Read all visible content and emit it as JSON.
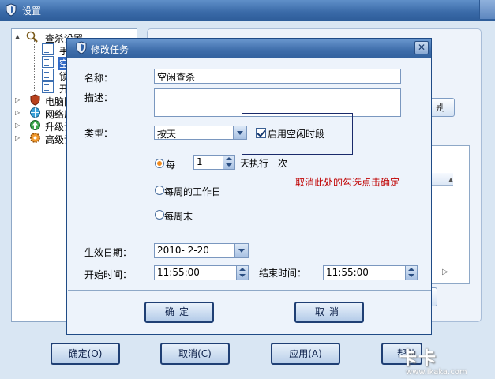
{
  "window": {
    "title": "设置",
    "tree": [
      {
        "label": "查杀设置",
        "expanded": true
      },
      {
        "label": "手"
      },
      {
        "label": "空"
      },
      {
        "label": "锁"
      },
      {
        "label": "开"
      },
      {
        "label": "电脑防"
      },
      {
        "label": "网络层"
      },
      {
        "label": "升级设"
      },
      {
        "label": "高级设"
      }
    ],
    "partial_button": "别",
    "buttons": {
      "ok": "确定(O)",
      "cancel": "取消(C)",
      "apply": "应用(A)",
      "help": "帮助"
    }
  },
  "dialog": {
    "title": "修改任务",
    "name_label": "名称：",
    "name_value": "空闲查杀",
    "desc_label": "描述：",
    "desc_value": "",
    "type_label": "类型：",
    "type_value": "按天",
    "idle_checkbox_label": "启用空闲时段",
    "idle_checked": true,
    "radio_every": "每",
    "interval_value": "1",
    "interval_suffix": "天执行一次",
    "radio_workday": "每周的工作日",
    "radio_weekend": "每周末",
    "selected_radio": "每",
    "effective_date_label": "生效日期：",
    "effective_date_value": "2010- 2-20",
    "start_time_label": "开始时间：",
    "start_time_value": "11:55:00",
    "end_time_label": "结束时间：",
    "end_time_value": "11:55:00",
    "ok_button": "确定",
    "cancel_button": "取消"
  },
  "annotation": "取消此处的勾选点击确定",
  "watermark": {
    "logo": "卡卡",
    "url": "www.ikaka.com"
  },
  "colors": {
    "title_bar": "#3a6aa8",
    "annotation": "#c00000",
    "radio_selected": "#f08a1d"
  }
}
